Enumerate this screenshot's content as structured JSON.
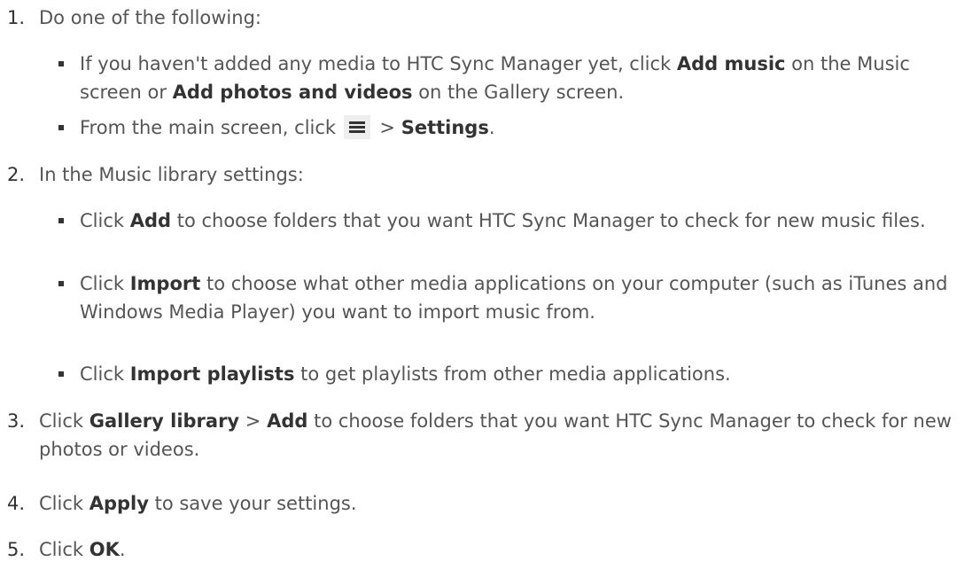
{
  "steps": [
    {
      "num": "1.",
      "text": "Do one of the following:",
      "subs": [
        {
          "pre": "If you haven't added any media to HTC Sync Manager yet, click ",
          "b1": "Add music",
          "mid": " on the Music screen or ",
          "b2": "Add photos and videos",
          "post": " on the Gallery screen."
        },
        {
          "pre": "From the main screen, click ",
          "icon": "menu-icon",
          "mid": " > ",
          "b1": "Settings",
          "post": "."
        }
      ]
    },
    {
      "num": "2.",
      "text": "In the Music library settings:",
      "subs": [
        {
          "pre": "Click ",
          "b1": "Add",
          "post": " to choose folders that you want HTC Sync Manager to check for new music files."
        },
        {
          "pre": "Click ",
          "b1": "Import",
          "post": " to choose what other media applications on your computer (such as iTunes and Windows Media Player) you want to import music from."
        },
        {
          "pre": "Click ",
          "b1": "Import playlists",
          "post": " to get playlists from other media applications."
        }
      ]
    },
    {
      "num": "3.",
      "pre": "Click ",
      "b1": "Gallery library",
      "mid": " > ",
      "b2": "Add",
      "post": " to choose folders that you want HTC Sync Manager to check for new photos or videos."
    },
    {
      "num": "4.",
      "pre": "Click ",
      "b1": "Apply",
      "post": " to save your settings."
    },
    {
      "num": "5.",
      "pre": "Click ",
      "b1": "OK",
      "post": "."
    }
  ]
}
